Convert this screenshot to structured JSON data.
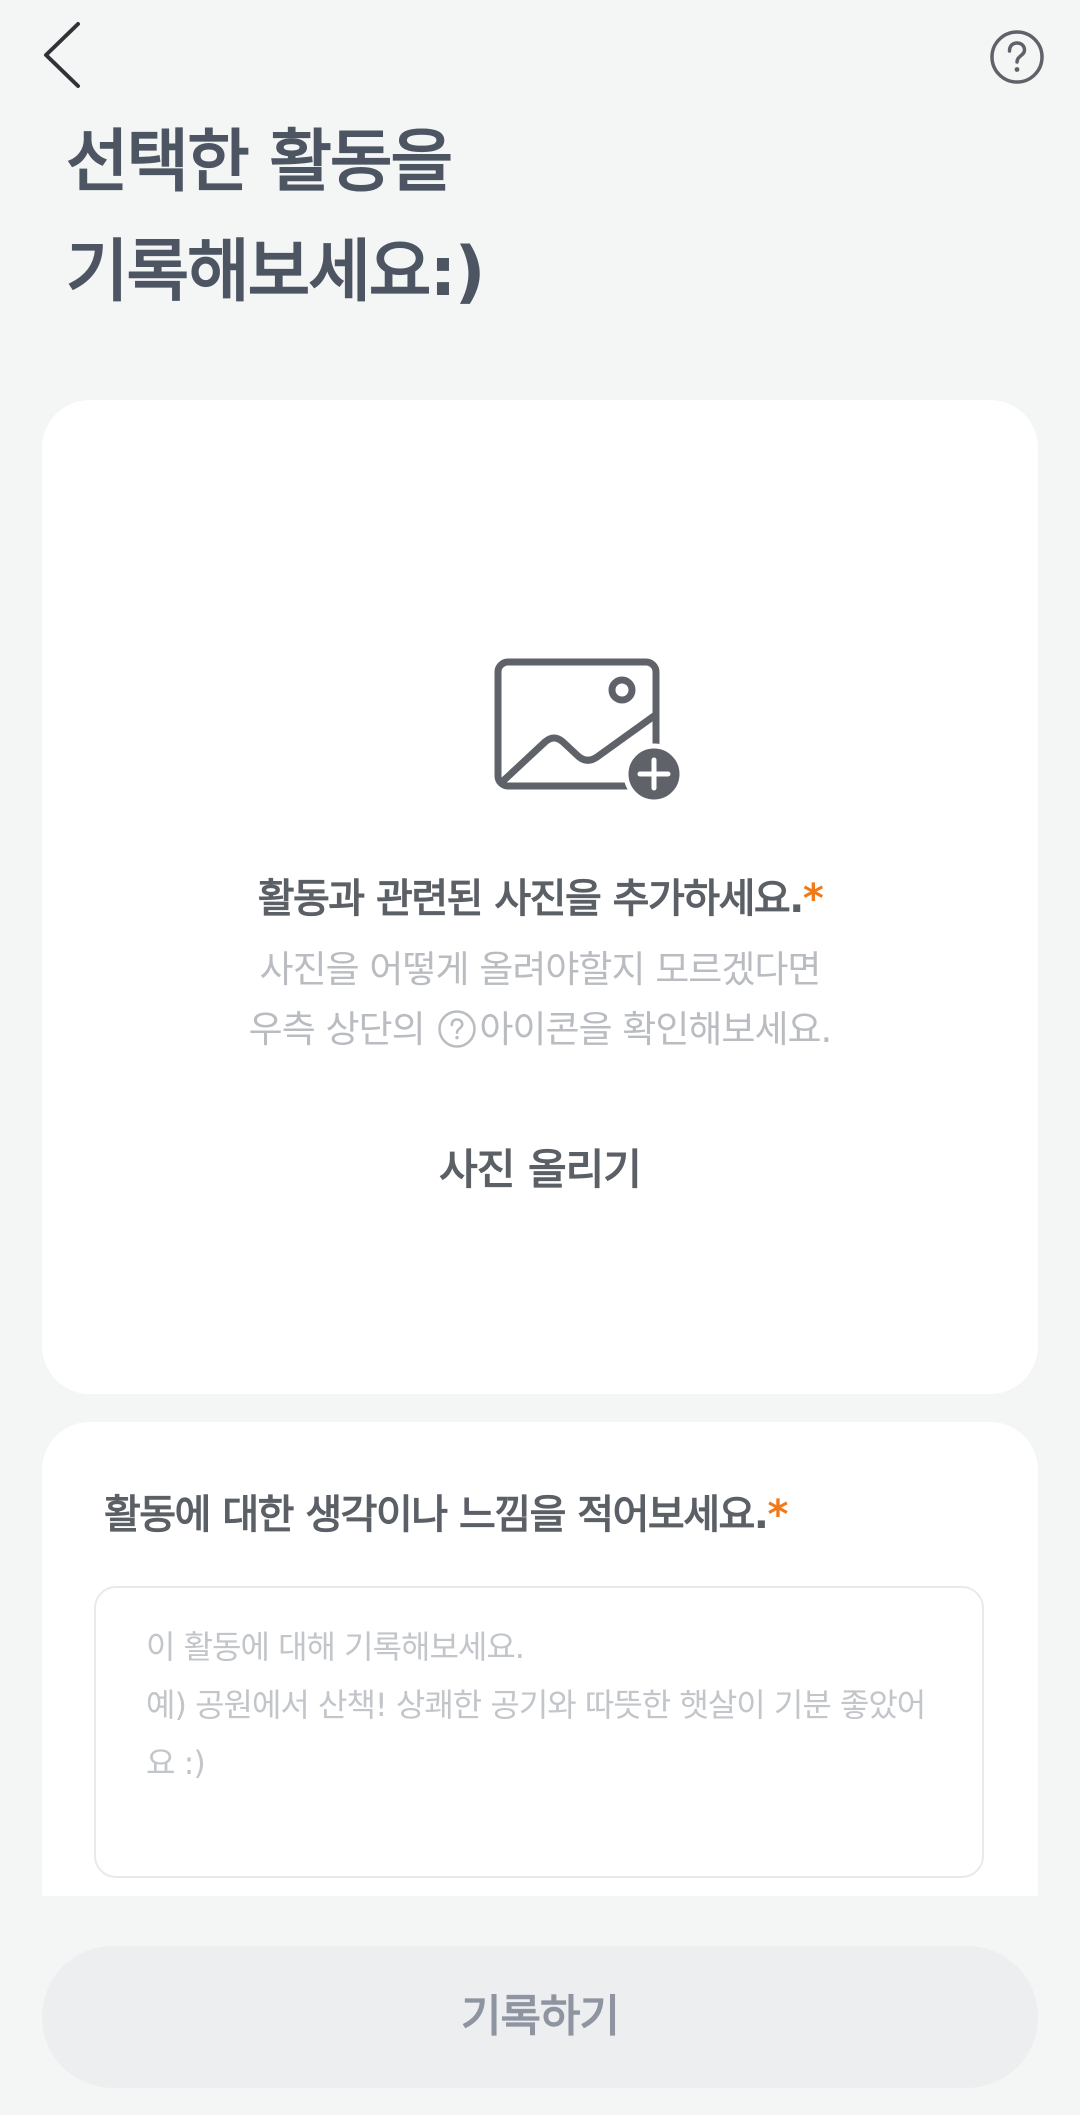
{
  "header": {
    "back_icon": "chevron-left-icon",
    "help_icon": "question-circle-icon",
    "title_lines": [
      "선택한 활동을",
      "기록해보세요:)"
    ]
  },
  "photo_section": {
    "icon": "image-add-icon",
    "title": "활동과 관련된 사진을 추가하세요.",
    "required_mark": "*",
    "description_line1": "사진을 어떻게 올려야할지 모르겠다면",
    "description_line2_before": "우측 상단의",
    "description_line2_after": "아이콘을 확인해보세요.",
    "upload_label": "사진 올리기"
  },
  "note_section": {
    "title": "활동에 대한 생각이나 느낌을 적어보세요.",
    "required_mark": "*",
    "value": "",
    "placeholder": "이 활동에 대해 기록해보세요.\n예) 공원에서 산책! 상쾌한 공기와 따뜻한 햇살이 기분 좋았어요 :)"
  },
  "submit": {
    "label": "기록하기"
  },
  "colors": {
    "background": "#f4f5f5",
    "title": "#4d5563",
    "accent": "#f07a1a",
    "icon": "#5f6369",
    "disabled_button": "#eceef0",
    "disabled_text": "#8e95a0"
  }
}
